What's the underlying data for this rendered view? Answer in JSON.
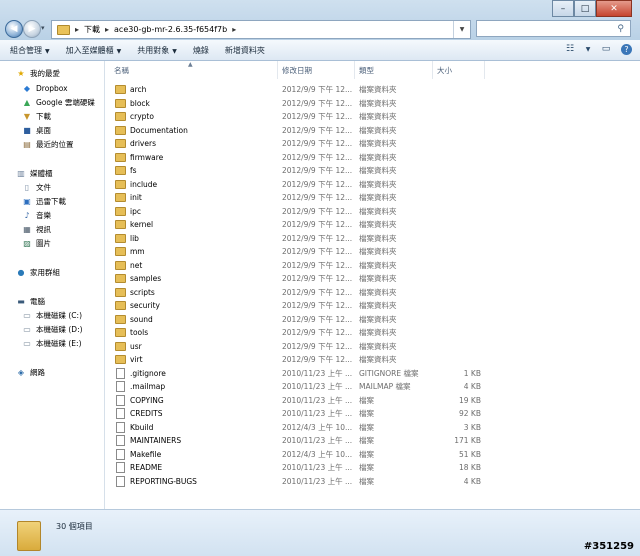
{
  "address": {
    "crumbs": [
      "下載",
      "ace30-gb-mr-2.6.35-f654f7b"
    ],
    "search_placeholder": ""
  },
  "toolbar": {
    "organize": "組合管理",
    "include_in_library": "加入至媒體櫃",
    "share_with": "共用對象",
    "burn": "燒錄",
    "new_folder": "新增資料夾"
  },
  "nav": {
    "favorites_header": "我的最愛",
    "favorites": [
      "Dropbox",
      "Google 雲端硬碟",
      "下載",
      "桌面",
      "最近的位置"
    ],
    "libraries_header": "媒體櫃",
    "libraries": [
      "文件",
      "迅雷下載",
      "音樂",
      "視訊",
      "圖片"
    ],
    "homegroup": "家用群組",
    "computer_header": "電腦",
    "drives": [
      "本機磁碟 (C:)",
      "本機磁碟 (D:)",
      "本機磁碟 (E:)"
    ],
    "network": "網路"
  },
  "columns": {
    "name": "名稱",
    "date": "修改日期",
    "type": "類型",
    "size": "大小"
  },
  "files": [
    {
      "name": "arch",
      "date": "2012/9/9 下午 12...",
      "type": "檔案資料夾",
      "size": "",
      "kind": "folder"
    },
    {
      "name": "block",
      "date": "2012/9/9 下午 12...",
      "type": "檔案資料夾",
      "size": "",
      "kind": "folder"
    },
    {
      "name": "crypto",
      "date": "2012/9/9 下午 12...",
      "type": "檔案資料夾",
      "size": "",
      "kind": "folder"
    },
    {
      "name": "Documentation",
      "date": "2012/9/9 下午 12...",
      "type": "檔案資料夾",
      "size": "",
      "kind": "folder"
    },
    {
      "name": "drivers",
      "date": "2012/9/9 下午 12...",
      "type": "檔案資料夾",
      "size": "",
      "kind": "folder"
    },
    {
      "name": "firmware",
      "date": "2012/9/9 下午 12...",
      "type": "檔案資料夾",
      "size": "",
      "kind": "folder"
    },
    {
      "name": "fs",
      "date": "2012/9/9 下午 12...",
      "type": "檔案資料夾",
      "size": "",
      "kind": "folder"
    },
    {
      "name": "include",
      "date": "2012/9/9 下午 12...",
      "type": "檔案資料夾",
      "size": "",
      "kind": "folder"
    },
    {
      "name": "init",
      "date": "2012/9/9 下午 12...",
      "type": "檔案資料夾",
      "size": "",
      "kind": "folder"
    },
    {
      "name": "ipc",
      "date": "2012/9/9 下午 12...",
      "type": "檔案資料夾",
      "size": "",
      "kind": "folder"
    },
    {
      "name": "kernel",
      "date": "2012/9/9 下午 12...",
      "type": "檔案資料夾",
      "size": "",
      "kind": "folder"
    },
    {
      "name": "lib",
      "date": "2012/9/9 下午 12...",
      "type": "檔案資料夾",
      "size": "",
      "kind": "folder"
    },
    {
      "name": "mm",
      "date": "2012/9/9 下午 12...",
      "type": "檔案資料夾",
      "size": "",
      "kind": "folder"
    },
    {
      "name": "net",
      "date": "2012/9/9 下午 12...",
      "type": "檔案資料夾",
      "size": "",
      "kind": "folder"
    },
    {
      "name": "samples",
      "date": "2012/9/9 下午 12...",
      "type": "檔案資料夾",
      "size": "",
      "kind": "folder"
    },
    {
      "name": "scripts",
      "date": "2012/9/9 下午 12...",
      "type": "檔案資料夾",
      "size": "",
      "kind": "folder"
    },
    {
      "name": "security",
      "date": "2012/9/9 下午 12...",
      "type": "檔案資料夾",
      "size": "",
      "kind": "folder"
    },
    {
      "name": "sound",
      "date": "2012/9/9 下午 12...",
      "type": "檔案資料夾",
      "size": "",
      "kind": "folder"
    },
    {
      "name": "tools",
      "date": "2012/9/9 下午 12...",
      "type": "檔案資料夾",
      "size": "",
      "kind": "folder"
    },
    {
      "name": "usr",
      "date": "2012/9/9 下午 12...",
      "type": "檔案資料夾",
      "size": "",
      "kind": "folder"
    },
    {
      "name": "virt",
      "date": "2012/9/9 下午 12...",
      "type": "檔案資料夾",
      "size": "",
      "kind": "folder"
    },
    {
      "name": ".gitignore",
      "date": "2010/11/23 上午 ...",
      "type": "GITIGNORE 檔案",
      "size": "1 KB",
      "kind": "file"
    },
    {
      "name": ".mailmap",
      "date": "2010/11/23 上午 ...",
      "type": "MAILMAP 檔案",
      "size": "4 KB",
      "kind": "file"
    },
    {
      "name": "COPYING",
      "date": "2010/11/23 上午 ...",
      "type": "檔案",
      "size": "19 KB",
      "kind": "file"
    },
    {
      "name": "CREDITS",
      "date": "2010/11/23 上午 ...",
      "type": "檔案",
      "size": "92 KB",
      "kind": "file"
    },
    {
      "name": "Kbuild",
      "date": "2012/4/3 上午 10...",
      "type": "檔案",
      "size": "3 KB",
      "kind": "file"
    },
    {
      "name": "MAINTAINERS",
      "date": "2010/11/23 上午 ...",
      "type": "檔案",
      "size": "171 KB",
      "kind": "file"
    },
    {
      "name": "Makefile",
      "date": "2012/4/3 上午 10...",
      "type": "檔案",
      "size": "51 KB",
      "kind": "file"
    },
    {
      "name": "README",
      "date": "2010/11/23 上午 ...",
      "type": "檔案",
      "size": "18 KB",
      "kind": "file"
    },
    {
      "name": "REPORTING-BUGS",
      "date": "2010/11/23 上午 ...",
      "type": "檔案",
      "size": "4 KB",
      "kind": "file"
    }
  ],
  "status": {
    "item_count": "30 個項目"
  },
  "watermark": "#351259",
  "colors": {
    "folder": "#e6be57",
    "chrome": "#c6d9ec"
  }
}
